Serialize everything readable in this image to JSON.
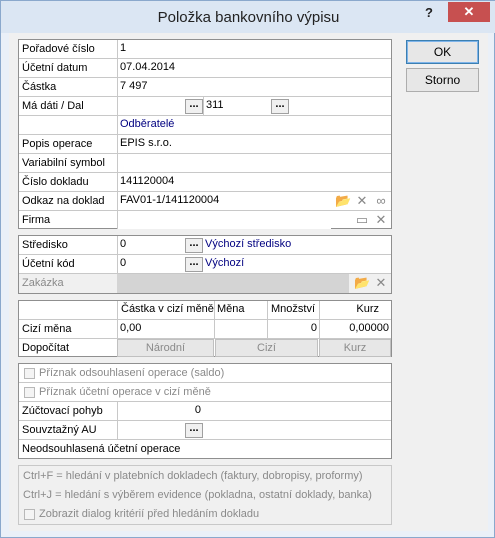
{
  "window": {
    "title": "Položka bankovního výpisu",
    "help": "?",
    "close": "✕"
  },
  "buttons": {
    "ok": "OK",
    "storno": "Storno"
  },
  "fields": {
    "poradove_cislo": {
      "label": "Pořadové číslo",
      "value": "1"
    },
    "ucetni_datum": {
      "label": "Účetní datum",
      "value": "07.04.2014"
    },
    "castka": {
      "label": "Částka",
      "value": "7 497"
    },
    "ma_dati": {
      "label": "Má dáti / Dal",
      "value_dal": "311",
      "note": "Odběratelé"
    },
    "popis": {
      "label": "Popis operace",
      "value": "EPIS s.r.o."
    },
    "variabilni": {
      "label": "Variabilní symbol",
      "value": ""
    },
    "cislo_dokladu": {
      "label": "Číslo dokladu",
      "value": "141120004"
    },
    "odkaz": {
      "label": "Odkaz na doklad",
      "value": "FAV01-1/141120004"
    },
    "firma": {
      "label": "Firma",
      "value": ""
    }
  },
  "sec2": {
    "stredisko": {
      "label": "Středisko",
      "value": "0",
      "desc": "Výchozí středisko"
    },
    "ucetni_kod": {
      "label": "Účetní kód",
      "value": "0",
      "desc": "Výchozí"
    },
    "zakazka": {
      "label": "Zakázka",
      "value": ""
    }
  },
  "currency": {
    "headers": [
      "Částka v cizí měně",
      "Měna",
      "Množství",
      "Kurz"
    ],
    "cizi_mena_label": "Cizí měna",
    "values": [
      "0,00",
      "",
      "0",
      "0,00000"
    ],
    "dopocitat_label": "Dopočítat",
    "buttons": [
      "Národní",
      "Cizí",
      "Kurz"
    ]
  },
  "flags": {
    "saldo": "Příznak odsouhlasení operace (saldo)",
    "cizi_mena": "Příznak účetní operace v cizí měně",
    "zuctovaci": {
      "label": "Zúčtovací pohyb",
      "value": "0"
    },
    "souvztazny": {
      "label": "Souvztažný AU",
      "value": ""
    },
    "neodsouhlasena": "Neodsouhlasená účetní operace"
  },
  "hints": {
    "ctrl_f": "Ctrl+F = hledání v platebních dokladech (faktury, dobropisy, proformy)",
    "ctrl_j": "Ctrl+J = hledání s výběrem evidence (pokladna, ostatní doklady, banka)",
    "dialog": "Zobrazit dialog kritérií před hledáním dokladu"
  },
  "icons": {
    "dots": "...",
    "open": "folder-open-icon",
    "delete": "delete-x-icon",
    "link": "link-icon"
  }
}
